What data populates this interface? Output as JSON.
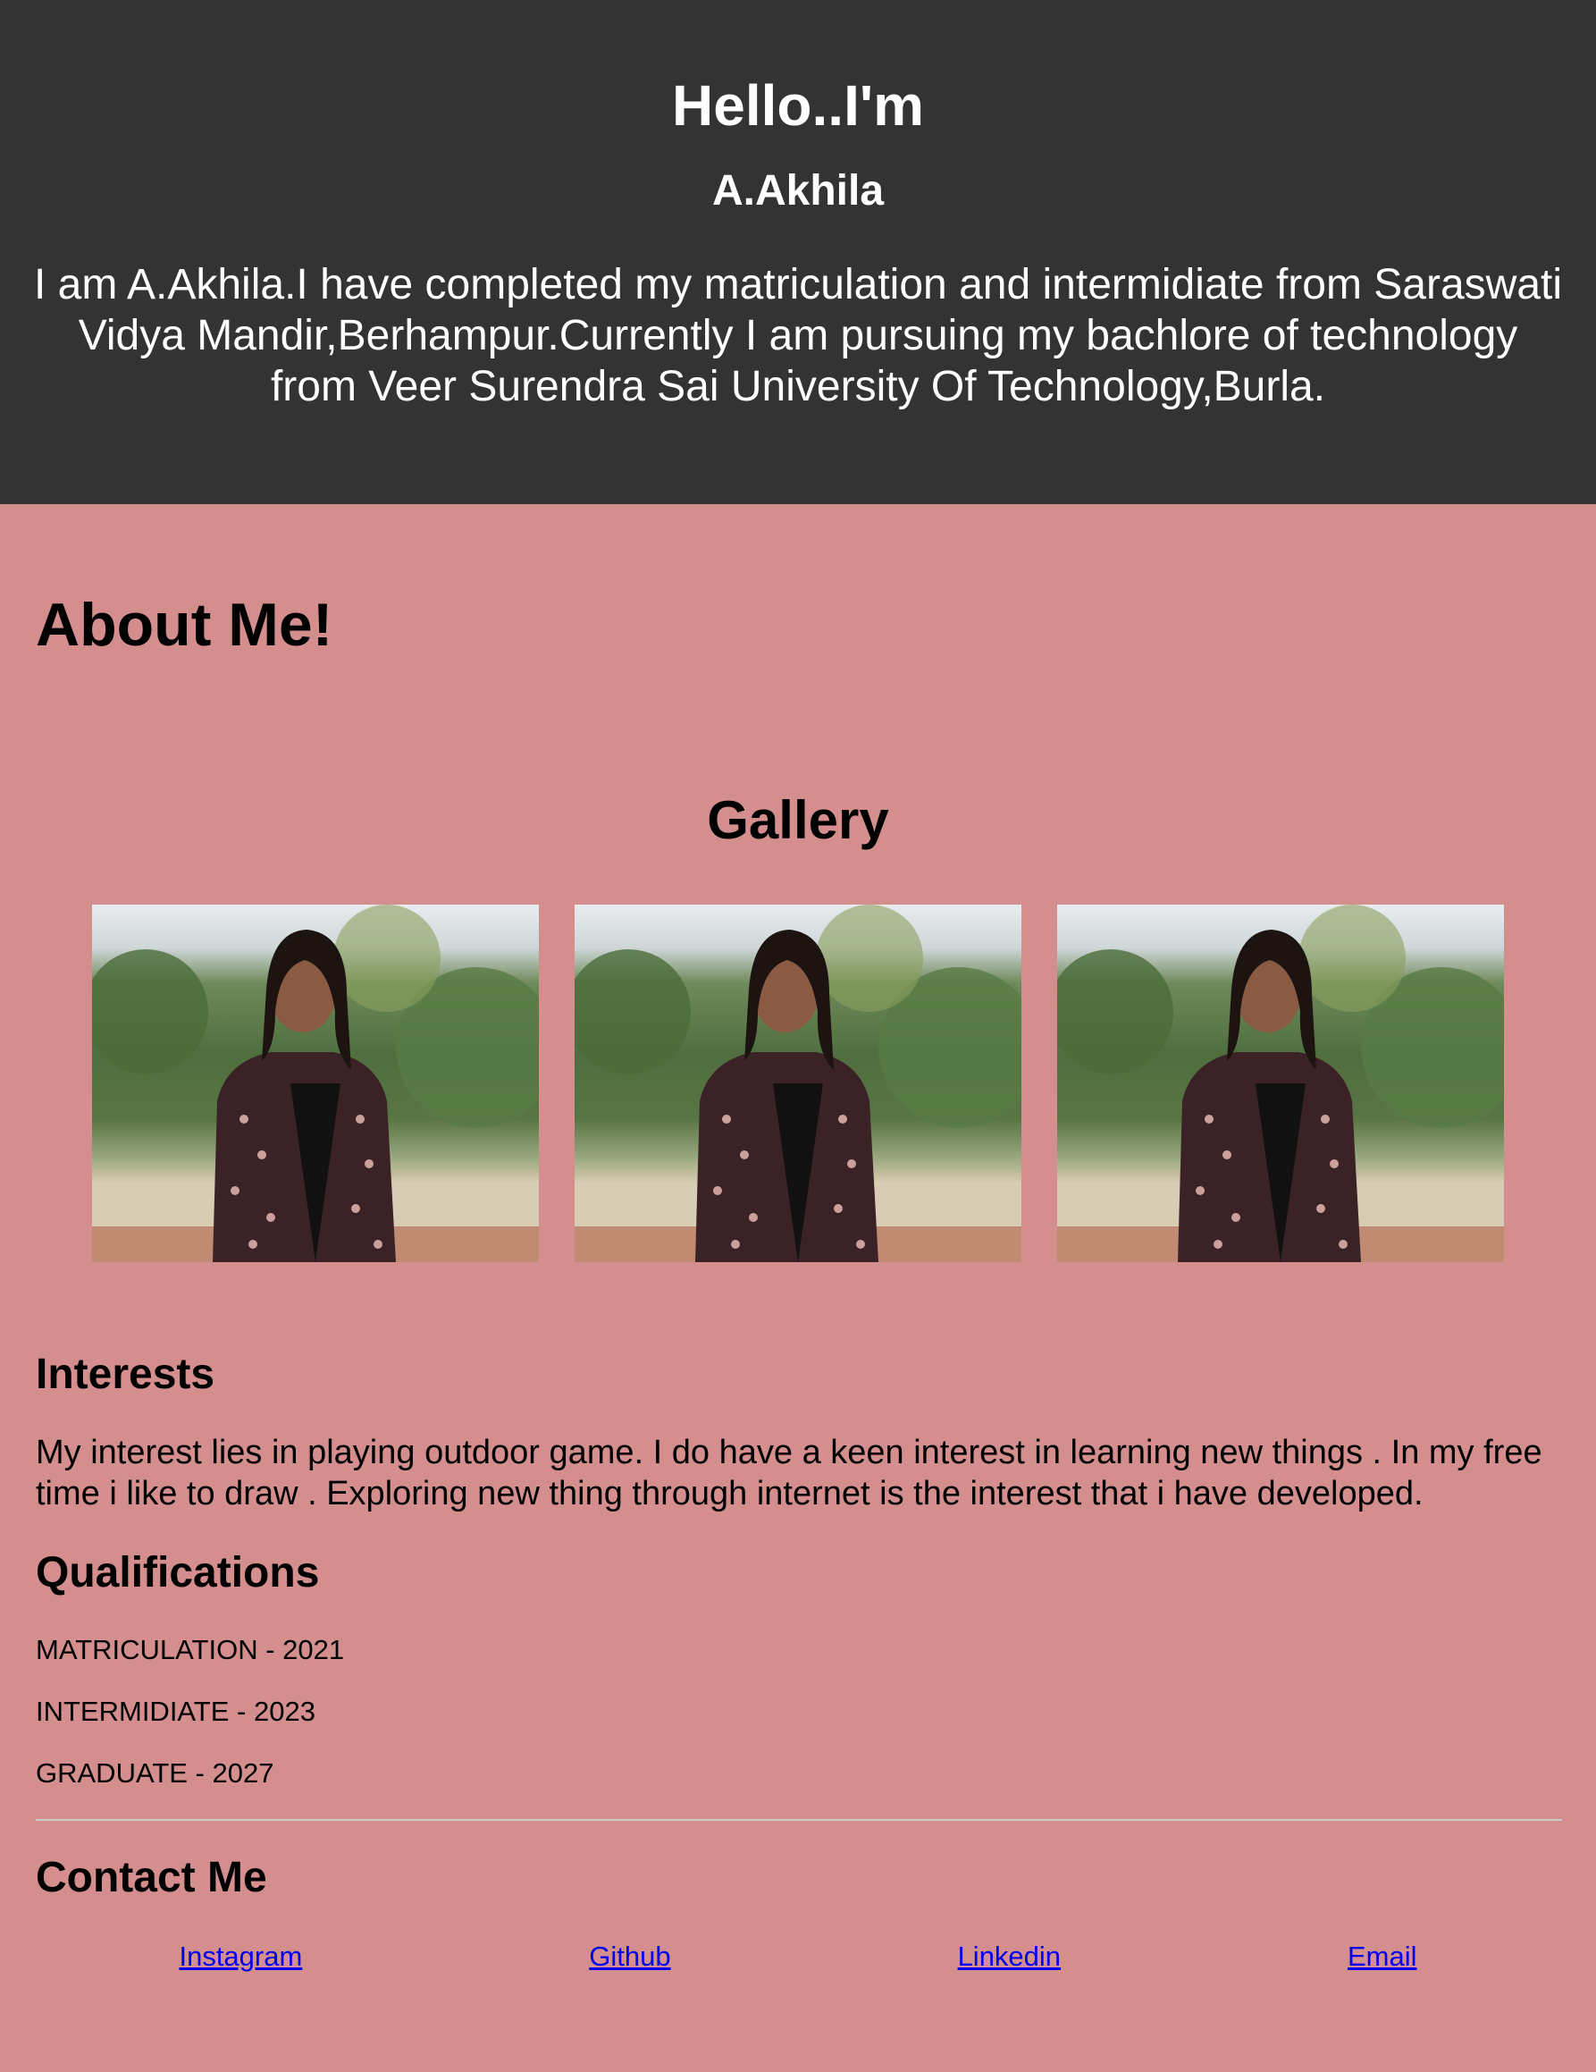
{
  "hero": {
    "greeting": "Hello..I'm",
    "name": "A.Akhila",
    "bio_lines": [
      "I am A.Akhila.I have completed my matriculation and intermidiate from Saraswati",
      "Vidya Mandir,Berhampur.Currently I am pursuing my bachlore of technology",
      "from Veer Surendra Sai University Of Technology,Burla."
    ]
  },
  "about": {
    "title": "About Me!"
  },
  "gallery": {
    "title": "Gallery",
    "photos": [
      "profile-photo",
      "profile-photo",
      "profile-photo"
    ]
  },
  "interests": {
    "title": "Interests",
    "text": "My interest lies in playing outdoor game. I do have a keen interest in learning new things . In my free time i like to draw . Exploring new thing through internet is the interest that i have developed."
  },
  "qualifications": {
    "title": "Qualifications",
    "items": [
      "MATRICULATION - 2021",
      "INTERMIDIATE - 2023",
      "GRADUATE - 2027"
    ]
  },
  "contact": {
    "title": "Contact Me",
    "links": [
      "Instagram",
      "Github",
      "Linkedin",
      "Email"
    ]
  },
  "colors": {
    "hero_bg": "#333333",
    "page_bg": "#d38e8d",
    "link": "#0000ee"
  }
}
